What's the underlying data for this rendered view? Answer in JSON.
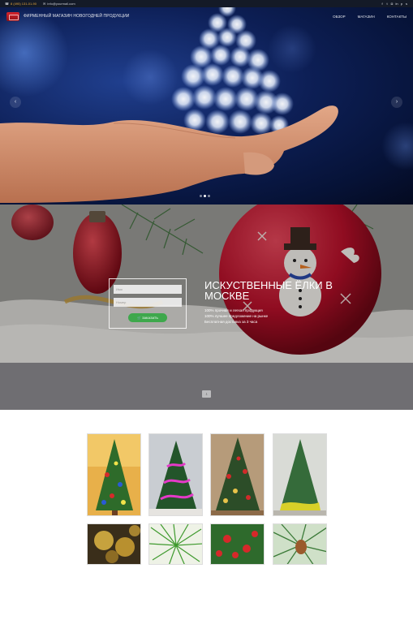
{
  "topbar": {
    "phone": "8 (495) 131-01-90",
    "email": "info@yourmail.com",
    "social_icons": [
      "facebook-icon",
      "twitter-icon",
      "instagram-icon",
      "linkedin-icon",
      "pinterest-icon",
      "skype-icon"
    ]
  },
  "header": {
    "brand": "ФИРМЕННЫЙ МАГАЗИН НОВОГОДНЕЙ ПРОДУКЦИИ",
    "nav": [
      "ОБЗОР",
      "МАГАЗИН",
      "КОНТАКТЫ"
    ]
  },
  "hero": {
    "slides": 3,
    "active_slide": 1
  },
  "promo": {
    "name_placeholder": "Имя",
    "phone_placeholder": "Номер",
    "button_label": "ЗАКАЗАТЬ",
    "title": "ИСКУСТВЕННЫЕ ЁЛКИ В МОСКВЕ",
    "features": [
      "100% прочная и легкая продукция",
      "100% лучшее предложение на рынке",
      "Бесплатная доставка за 3 часа"
    ]
  },
  "colors": {
    "topbar_bg": "#141a27",
    "hero_bg": "#0d1f56",
    "button_green": "#3ea84c",
    "band_gray": "#6f6e72"
  }
}
